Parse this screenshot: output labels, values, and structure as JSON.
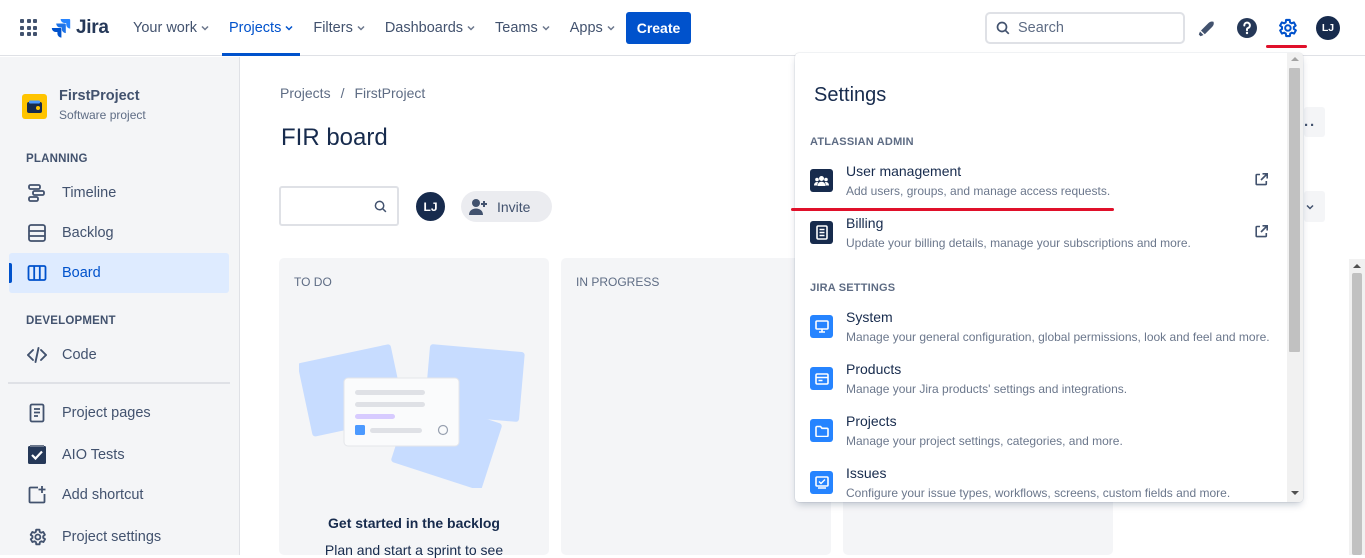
{
  "topbar": {
    "logo_text": "Jira",
    "nav": [
      {
        "label": "Your work",
        "active": false
      },
      {
        "label": "Projects",
        "active": true
      },
      {
        "label": "Filters",
        "active": false
      },
      {
        "label": "Dashboards",
        "active": false
      },
      {
        "label": "Teams",
        "active": false
      },
      {
        "label": "Apps",
        "active": false
      }
    ],
    "create_label": "Create",
    "search_placeholder": "Search",
    "avatar_initials": "LJ",
    "brand_color": "#0052cc",
    "highlight_color": "#e0102a"
  },
  "sidebar": {
    "project_name": "FirstProject",
    "project_type": "Software project",
    "sections": [
      {
        "title": "PLANNING",
        "items": [
          {
            "label": "Timeline",
            "icon": "timeline-icon"
          },
          {
            "label": "Backlog",
            "icon": "backlog-icon"
          },
          {
            "label": "Board",
            "icon": "board-icon",
            "active": true
          }
        ]
      },
      {
        "title": "DEVELOPMENT",
        "items": [
          {
            "label": "Code",
            "icon": "code-icon"
          }
        ]
      }
    ],
    "extra_items": [
      {
        "label": "Project pages",
        "icon": "page-icon"
      },
      {
        "label": "AIO Tests",
        "icon": "checkbox-icon"
      },
      {
        "label": "Add shortcut",
        "icon": "add-shortcut-icon"
      },
      {
        "label": "Project settings",
        "icon": "gear-icon"
      }
    ]
  },
  "main": {
    "breadcrumbs": [
      "Projects",
      "/",
      "FirstProject"
    ],
    "board_title": "FIR board",
    "avatar_initials": "LJ",
    "invite_label": "Invite",
    "columns": [
      {
        "title": "TO DO"
      },
      {
        "title": "IN PROGRESS"
      }
    ],
    "empty_title": "Get started in the backlog",
    "empty_text": "Plan and start a sprint to see"
  },
  "settings_menu": {
    "title": "Settings",
    "sections": [
      {
        "title": "ATLASSIAN ADMIN",
        "items": [
          {
            "name": "User management",
            "description": "Add users, groups, and manage access requests.",
            "icon": "users-icon",
            "external": true
          },
          {
            "name": "Billing",
            "description": "Update your billing details, manage your subscriptions and more.",
            "icon": "billing-icon",
            "external": true
          }
        ]
      },
      {
        "title": "JIRA SETTINGS",
        "items": [
          {
            "name": "System",
            "description": "Manage your general configuration, global permissions, look and feel and more.",
            "icon": "monitor-icon"
          },
          {
            "name": "Products",
            "description": "Manage your Jira products' settings and integrations.",
            "icon": "products-icon"
          },
          {
            "name": "Projects",
            "description": "Manage your project settings, categories, and more.",
            "icon": "folder-icon"
          },
          {
            "name": "Issues",
            "description": "Configure your issue types, workflows, screens, custom fields and more.",
            "icon": "issues-icon"
          }
        ]
      }
    ]
  }
}
